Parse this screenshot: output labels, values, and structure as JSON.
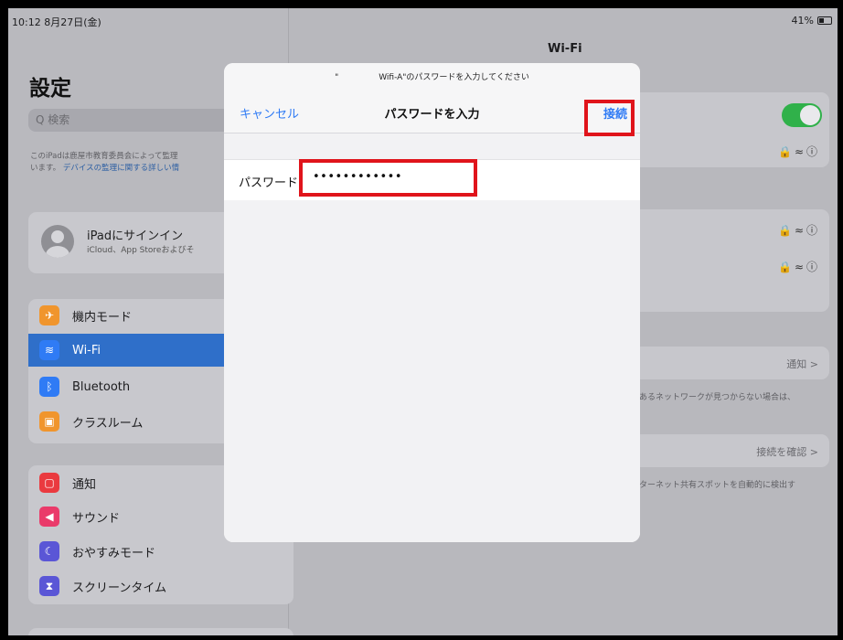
{
  "status_bar": {
    "time": "10:12  8月27日(金)",
    "battery": "41%"
  },
  "sidebar": {
    "title": "設定",
    "search_placeholder": "Q 検索",
    "supervision_text_1": "このiPadは鹿屋市教育委員会によって監理",
    "supervision_text_2": "います。",
    "supervision_link": "デバイスの監理に関する詳しい情",
    "signin": {
      "title": "iPadにサインイン",
      "subtitle": "iCloud、App Storeおよびそ"
    },
    "items": [
      {
        "label": "機内モード",
        "icon": "airplane-icon",
        "color": "#f0952d"
      },
      {
        "label": "Wi-Fi",
        "icon": "wifi-icon",
        "color": "#2f7bf5",
        "selected": true
      },
      {
        "label": "Bluetooth",
        "icon": "bluetooth-icon",
        "color": "#2f7bf5"
      },
      {
        "label": "クラスルーム",
        "icon": "classroom-icon",
        "color": "#f0952d"
      },
      {
        "label": "通知",
        "icon": "notification-icon",
        "color": "#ea3a3f"
      },
      {
        "label": "サウンド",
        "icon": "sound-icon",
        "color": "#ea3a6a"
      },
      {
        "label": "おやすみモード",
        "icon": "moon-icon",
        "color": "#5a56d6"
      },
      {
        "label": "スクリーンタイム",
        "icon": "hourglass-icon",
        "color": "#5a56d6"
      }
    ]
  },
  "wifi_pane": {
    "title": "Wi-Fi",
    "ask_to_join": "通知 >",
    "ask_note": "あるネットワークが見つからない場合は、",
    "hotspot": "接続を確認 >",
    "hotspot_note": "ターネット共有スポットを自動的に検出す"
  },
  "dialog": {
    "prompt_prefix": "\"",
    "prompt_suffix": "Wifi-A\"のパスワードを入力してください",
    "cancel_label": "キャンセル",
    "title": "パスワードを入力",
    "connect_label": "接続",
    "password_label": "パスワード",
    "password_value": "••••••••••••"
  },
  "annotations": {
    "highlight_color": "#e0141b"
  }
}
